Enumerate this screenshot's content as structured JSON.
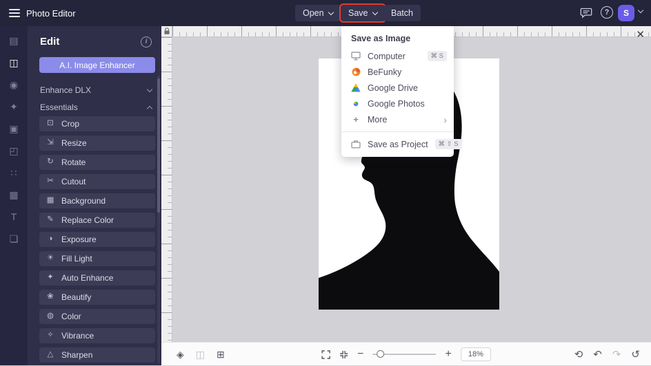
{
  "topbar": {
    "app_title": "Photo Editor",
    "open_label": "Open",
    "save_label": "Save",
    "batch_label": "Batch",
    "avatar_initial": "S",
    "help_glyph": "?"
  },
  "sidebar": {
    "items": [
      {
        "name": "photo-library",
        "glyph": "▤"
      },
      {
        "name": "edit",
        "glyph": "◫"
      },
      {
        "name": "touch-up",
        "glyph": "◉"
      },
      {
        "name": "effects",
        "glyph": "✦"
      },
      {
        "name": "frames",
        "glyph": "▣"
      },
      {
        "name": "overlays",
        "glyph": "◰"
      },
      {
        "name": "graphics",
        "glyph": "∷"
      },
      {
        "name": "textures",
        "glyph": "▦"
      },
      {
        "name": "text",
        "glyph": "T"
      },
      {
        "name": "layers",
        "glyph": "❏"
      }
    ]
  },
  "panel": {
    "title": "Edit",
    "info_glyph": "i",
    "ai_button_label": "A.I. Image Enhancer",
    "section_enhance": "Enhance DLX",
    "section_essentials": "Essentials",
    "tools": [
      {
        "label": "Crop",
        "glyph": "⊡"
      },
      {
        "label": "Resize",
        "glyph": "⇲"
      },
      {
        "label": "Rotate",
        "glyph": "↻"
      },
      {
        "label": "Cutout",
        "glyph": "✂"
      },
      {
        "label": "Background",
        "glyph": "▦"
      },
      {
        "label": "Replace Color",
        "glyph": "✎"
      },
      {
        "label": "Exposure",
        "glyph": "◑"
      },
      {
        "label": "Fill Light",
        "glyph": "☀"
      },
      {
        "label": "Auto Enhance",
        "glyph": "✦"
      },
      {
        "label": "Beautify",
        "glyph": "❀"
      },
      {
        "label": "Color",
        "glyph": "◍"
      },
      {
        "label": "Vibrance",
        "glyph": "✧"
      },
      {
        "label": "Sharpen",
        "glyph": "△"
      }
    ]
  },
  "save_menu": {
    "header": "Save as Image",
    "items": [
      {
        "label": "Computer",
        "shortcut": "⌘ S"
      },
      {
        "label": "BeFunky",
        "shortcut": ""
      },
      {
        "label": "Google Drive",
        "shortcut": ""
      },
      {
        "label": "Google Photos",
        "shortcut": ""
      },
      {
        "label": "More",
        "shortcut": ""
      }
    ],
    "more_chevron": "›",
    "project": {
      "label": "Save as Project",
      "shortcut": "⌘ ⇧ S"
    }
  },
  "statusbar": {
    "zoom_value": "18%",
    "icons": {
      "layers": "◈",
      "compare": "◫",
      "grid": "⊞",
      "minus": "−",
      "plus": "+",
      "reset": "⟲",
      "undo": "↶",
      "redo": "↷",
      "history": "↺"
    }
  },
  "canvas": {
    "close_glyph": "✕"
  }
}
